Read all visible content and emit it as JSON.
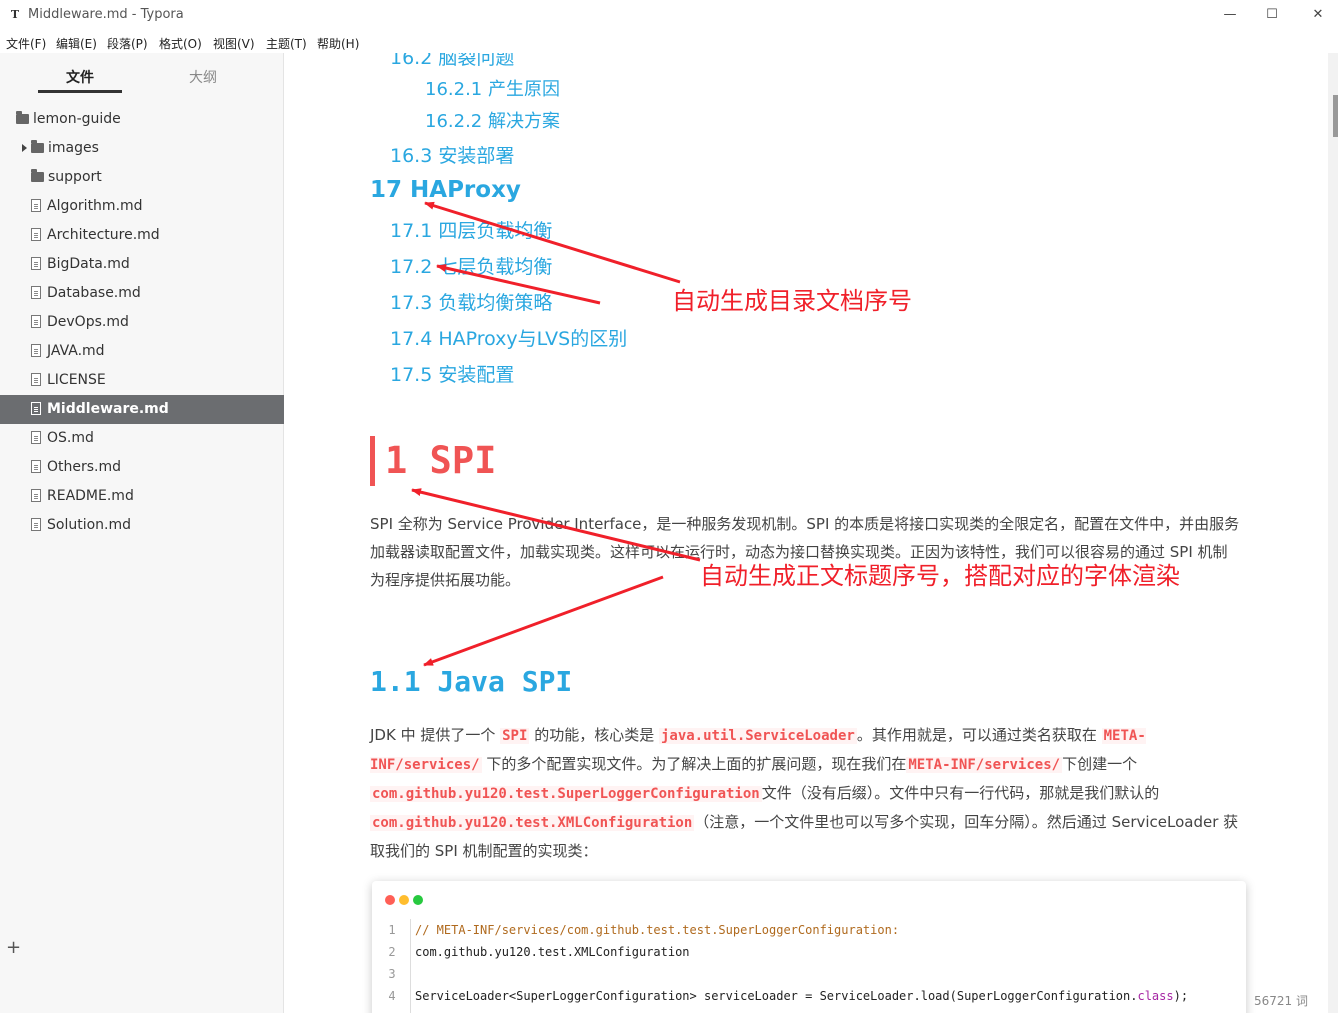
{
  "window": {
    "app_icon": "T",
    "title": "Middleware.md - Typora",
    "minimize": "—",
    "maximize": "☐",
    "close": "✕"
  },
  "menu": [
    "文件(F)",
    "编辑(E)",
    "段落(P)",
    "格式(O)",
    "视图(V)",
    "主题(T)",
    "帮助(H)"
  ],
  "sidebar": {
    "tab_files": "文件",
    "tab_outline": "大纲",
    "tree": [
      {
        "label": "lemon-guide",
        "type": "folder"
      },
      {
        "label": "images",
        "type": "folder-collapsed"
      },
      {
        "label": "support",
        "type": "folder"
      },
      {
        "label": "Algorithm.md",
        "type": "file"
      },
      {
        "label": "Architecture.md",
        "type": "file"
      },
      {
        "label": "BigData.md",
        "type": "file"
      },
      {
        "label": "Database.md",
        "type": "file"
      },
      {
        "label": "DevOps.md",
        "type": "file"
      },
      {
        "label": "JAVA.md",
        "type": "file"
      },
      {
        "label": "LICENSE",
        "type": "file"
      },
      {
        "label": "Middleware.md",
        "type": "file",
        "active": true
      },
      {
        "label": "OS.md",
        "type": "file"
      },
      {
        "label": "Others.md",
        "type": "file"
      },
      {
        "label": "README.md",
        "type": "file"
      },
      {
        "label": "Solution.md",
        "type": "file"
      }
    ],
    "add_button": "+",
    "collapse_button": "‹",
    "source_toggle": "</>"
  },
  "toc": {
    "item_16_2": "16.2 脑裂问题",
    "item_16_2_1": "16.2.1 产生原因",
    "item_16_2_2": "16.2.2 解决方案",
    "item_16_3": "16.3 安装部署",
    "item_17": "17 HAProxy",
    "item_17_1": "17.1 四层负载均衡",
    "item_17_2": "17.2 七层负载均衡",
    "item_17_3": "17.3 负载均衡策略",
    "item_17_4": "17.4 HAProxy与LVS的区别",
    "item_17_5": "17.5 安装配置"
  },
  "doc": {
    "h1": "1 SPI",
    "spi_para": "SPI 全称为 Service Provider Interface，是一种服务发现机制。SPI 的本质是将接口实现类的全限定名，配置在文件中，并由服务加载器读取配置文件，加载实现类。这样可以在运行时，动态为接口替换实现类。正因为该特性，我们可以很容易的通过 SPI 机制为程序提供拓展功能。",
    "h2": "1.1 Java SPI",
    "jdk_para": {
      "t1": "JDK 中 提供了一个 ",
      "c1": "SPI",
      "t2": " 的功能，核心类是 ",
      "c2": "java.util.ServiceLoader",
      "t3": "。其作用就是，可以通过类名获取在 ",
      "c3": "META-INF/services/",
      "t4": " 下的多个配置实现文件。为了解决上面的扩展问题，现在我们在",
      "c4": "META-INF/services/",
      "t5": "下创建一个",
      "c5": "com.github.yu120.test.SuperLoggerConfiguration",
      "t6": "文件（没有后缀）。文件中只有一行代码，那就是我们默认的",
      "c6": "com.github.yu120.test.XMLConfiguration",
      "t7": "（注意，一个文件里也可以写多个实现，回车分隔）。然后通过 ServiceLoader 获取我们的 SPI 机制配置的实现类："
    },
    "code": {
      "dots": [
        "#ff5f56",
        "#ffbd2e",
        "#27c93f"
      ],
      "lines": [
        {
          "n": "1",
          "text": "// META-INF/services/com.github.test.test.SuperLoggerConfiguration:",
          "comment": true
        },
        {
          "n": "2",
          "text": "com.github.yu120.test.XMLConfiguration"
        },
        {
          "n": "3",
          "text": ""
        },
        {
          "n": "4",
          "text_a": "ServiceLoader<SuperLoggerConfiguration> serviceLoader = ServiceLoader.load(SuperLoggerConfiguration.",
          "text_kw": "class",
          "text_b": ");"
        }
      ]
    }
  },
  "annotations": {
    "toc_note": "自动生成目录文档序号",
    "heading_note": "自动生成正文标题序号，搭配对应的字体渲染"
  },
  "status": {
    "word_count": "56721 词"
  },
  "colors": {
    "accent_blue": "#2aa7e0",
    "accent_red": "#f05454",
    "annotation_red": "#f0202a",
    "sidebar_active": "#6b6d70"
  }
}
